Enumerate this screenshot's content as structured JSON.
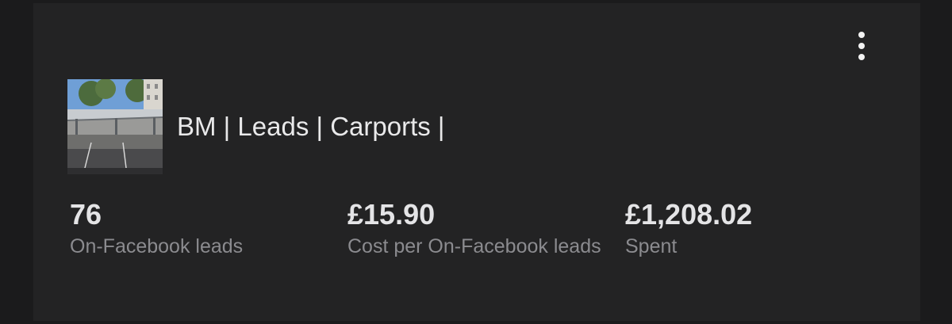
{
  "menu": {
    "icon": "more-vertical-icon"
  },
  "campaign": {
    "thumbnail_icon": "carport-photo",
    "title": "BM | Leads | Carports |"
  },
  "metrics": [
    {
      "value": "76",
      "label": "On-Facebook leads"
    },
    {
      "value": "£15.90",
      "label": "Cost per On-Facebook leads"
    },
    {
      "value": "£1,208.02",
      "label": "Spent"
    }
  ],
  "colors": {
    "background": "#232324",
    "title_text": "#e9e9ea",
    "value_text": "#e4e4e6",
    "label_text": "#8b8b8f"
  }
}
